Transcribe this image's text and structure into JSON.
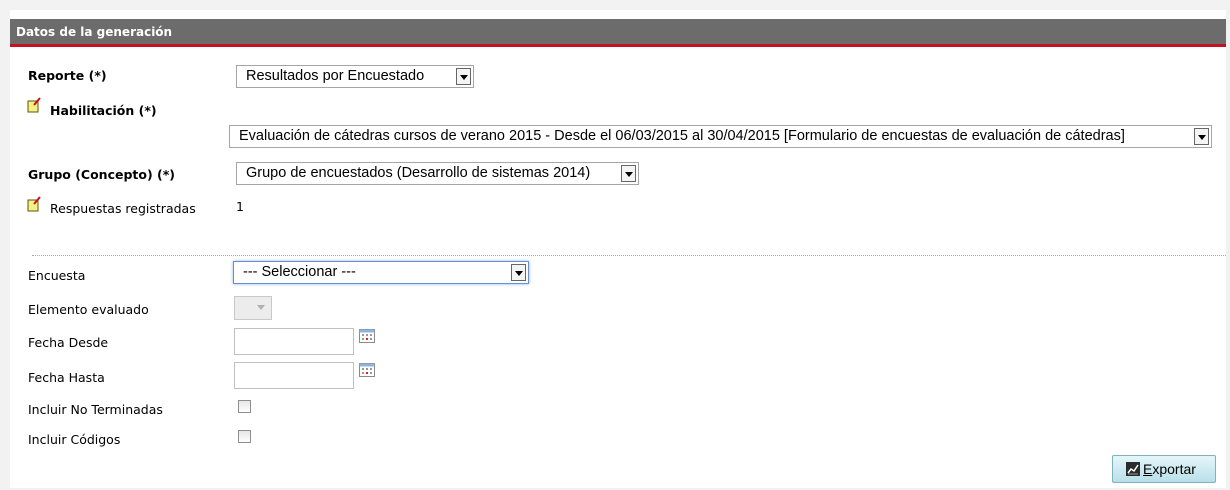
{
  "header": {
    "title": "Datos de la generación"
  },
  "fields": {
    "reporte": {
      "label": "Reporte (*)",
      "value": "Resultados por Encuestado"
    },
    "habilitacion": {
      "label": "Habilitación (*)",
      "value": "Evaluación de cátedras cursos de verano 2015 - Desde el 06/03/2015 al 30/04/2015 [Formulario de encuestas de evaluación de cátedras]"
    },
    "grupo": {
      "label": "Grupo (Concepto) (*)",
      "value": "Grupo de encuestados (Desarrollo de sistemas 2014)"
    },
    "respuestas": {
      "label": "Respuestas registradas",
      "value": "1"
    },
    "encuesta": {
      "label": "Encuesta",
      "value": "--- Seleccionar ---"
    },
    "elemento": {
      "label": "Elemento evaluado",
      "value": ""
    },
    "fecha_desde": {
      "label": "Fecha Desde",
      "value": ""
    },
    "fecha_hasta": {
      "label": "Fecha Hasta",
      "value": ""
    },
    "no_terminadas": {
      "label": "Incluir No Terminadas",
      "checked": false
    },
    "codigos": {
      "label": "Incluir Códigos",
      "checked": false
    }
  },
  "actions": {
    "export_first": "E",
    "export_rest": "xportar"
  },
  "icons": {
    "note": "note-icon",
    "calendar": "calendar-icon",
    "export": "chart-icon"
  }
}
